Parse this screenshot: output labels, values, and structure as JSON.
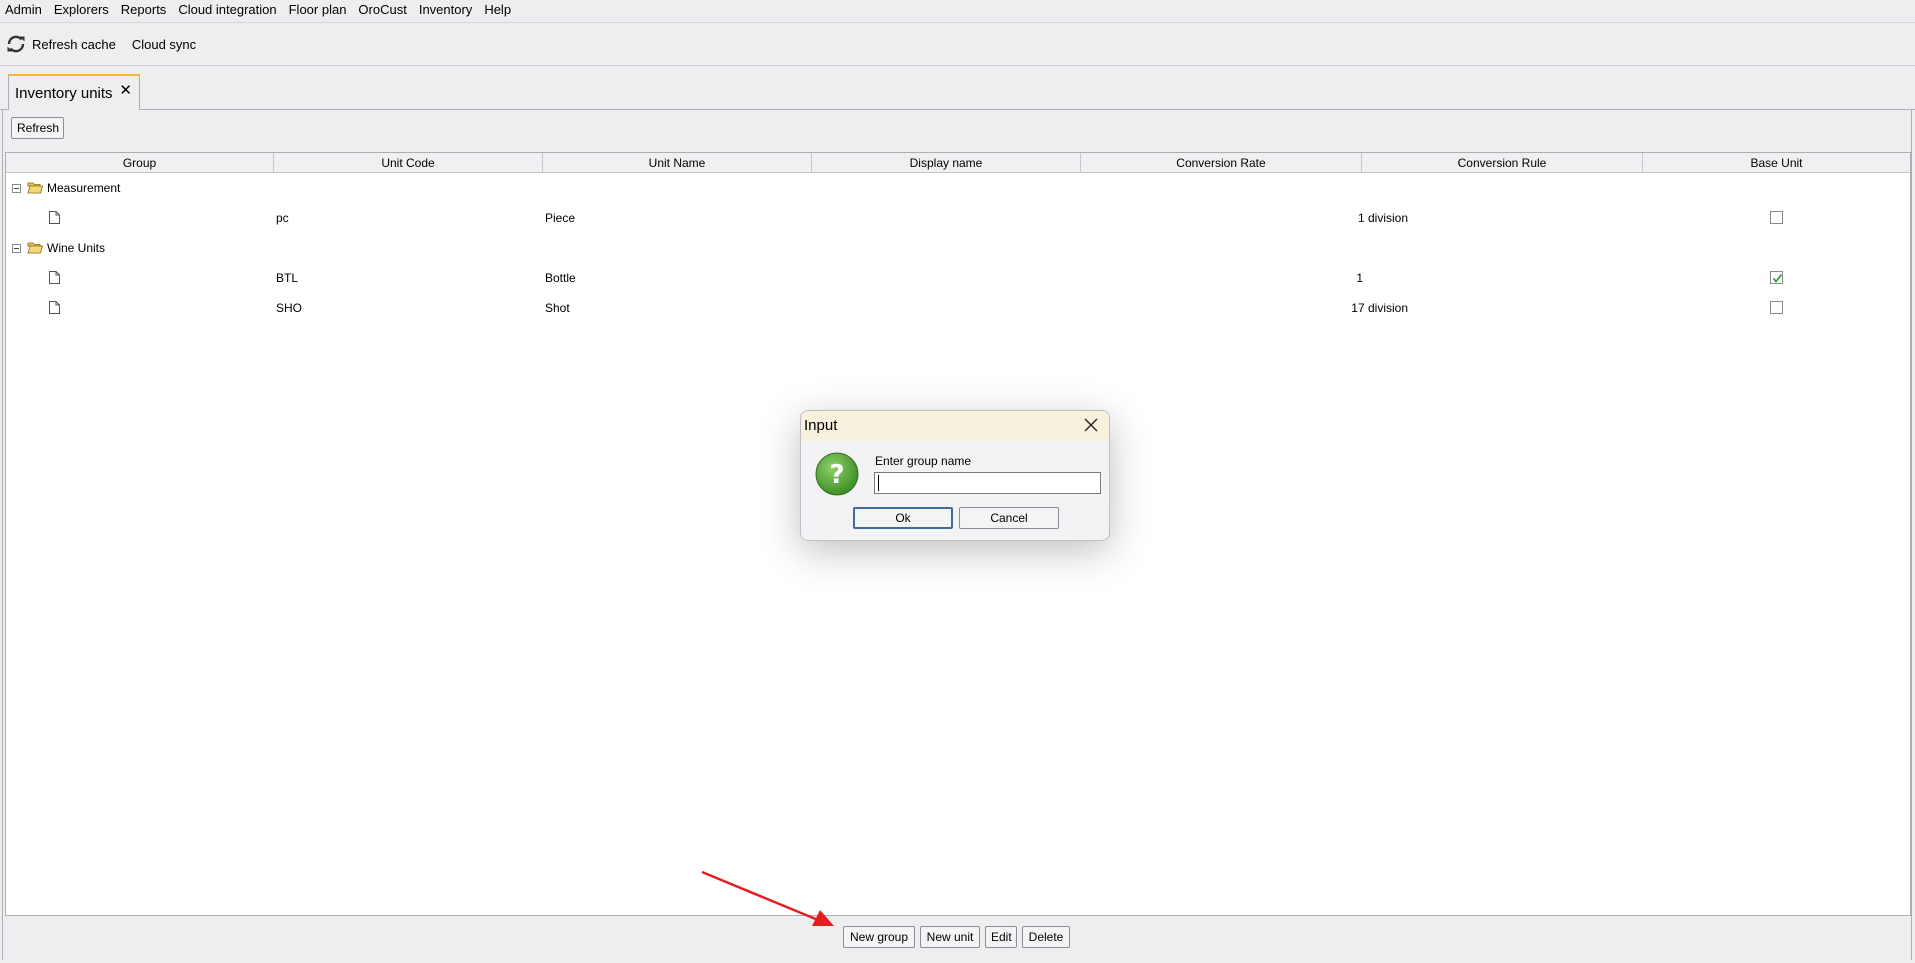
{
  "menu": [
    "Admin",
    "Explorers",
    "Reports",
    "Cloud integration",
    "Floor plan",
    "OroCust",
    "Inventory",
    "Help"
  ],
  "toolbar": {
    "refresh_cache": "Refresh cache",
    "cloud_sync": "Cloud sync"
  },
  "tab": {
    "label": "Inventory units",
    "close": "✕"
  },
  "panel": {
    "refresh": "Refresh"
  },
  "table": {
    "columns": [
      "Group",
      "Unit Code",
      "Unit Name",
      "Display name",
      "Conversion Rate",
      "Conversion Rule",
      "Base Unit"
    ],
    "groups": [
      {
        "name": "Measurement",
        "units": [
          {
            "code": "pc",
            "name": "Piece",
            "display_name": "",
            "conversion_rate": "1 division",
            "base_unit": false
          }
        ]
      },
      {
        "name": "Wine Units",
        "units": [
          {
            "code": "BTL",
            "name": "Bottle",
            "display_name": "",
            "conversion_rate": "1",
            "base_unit": true
          },
          {
            "code": "SHO",
            "name": "Shot",
            "display_name": "",
            "conversion_rate": "17 division",
            "base_unit": false
          }
        ]
      }
    ]
  },
  "bottom_buttons": {
    "new_group": "New group",
    "new_unit": "New unit",
    "edit": "Edit",
    "delete": "Delete"
  },
  "dialog": {
    "title": "Input",
    "prompt": "Enter group name",
    "input_value": "",
    "ok": "Ok",
    "cancel": "Cancel"
  },
  "colors": {
    "tab_accent": "#f5b63c",
    "folder": "#e9c45a",
    "check": "#3a9a3a",
    "icon_green": "#3f8f26",
    "arrow": "#e02020"
  }
}
